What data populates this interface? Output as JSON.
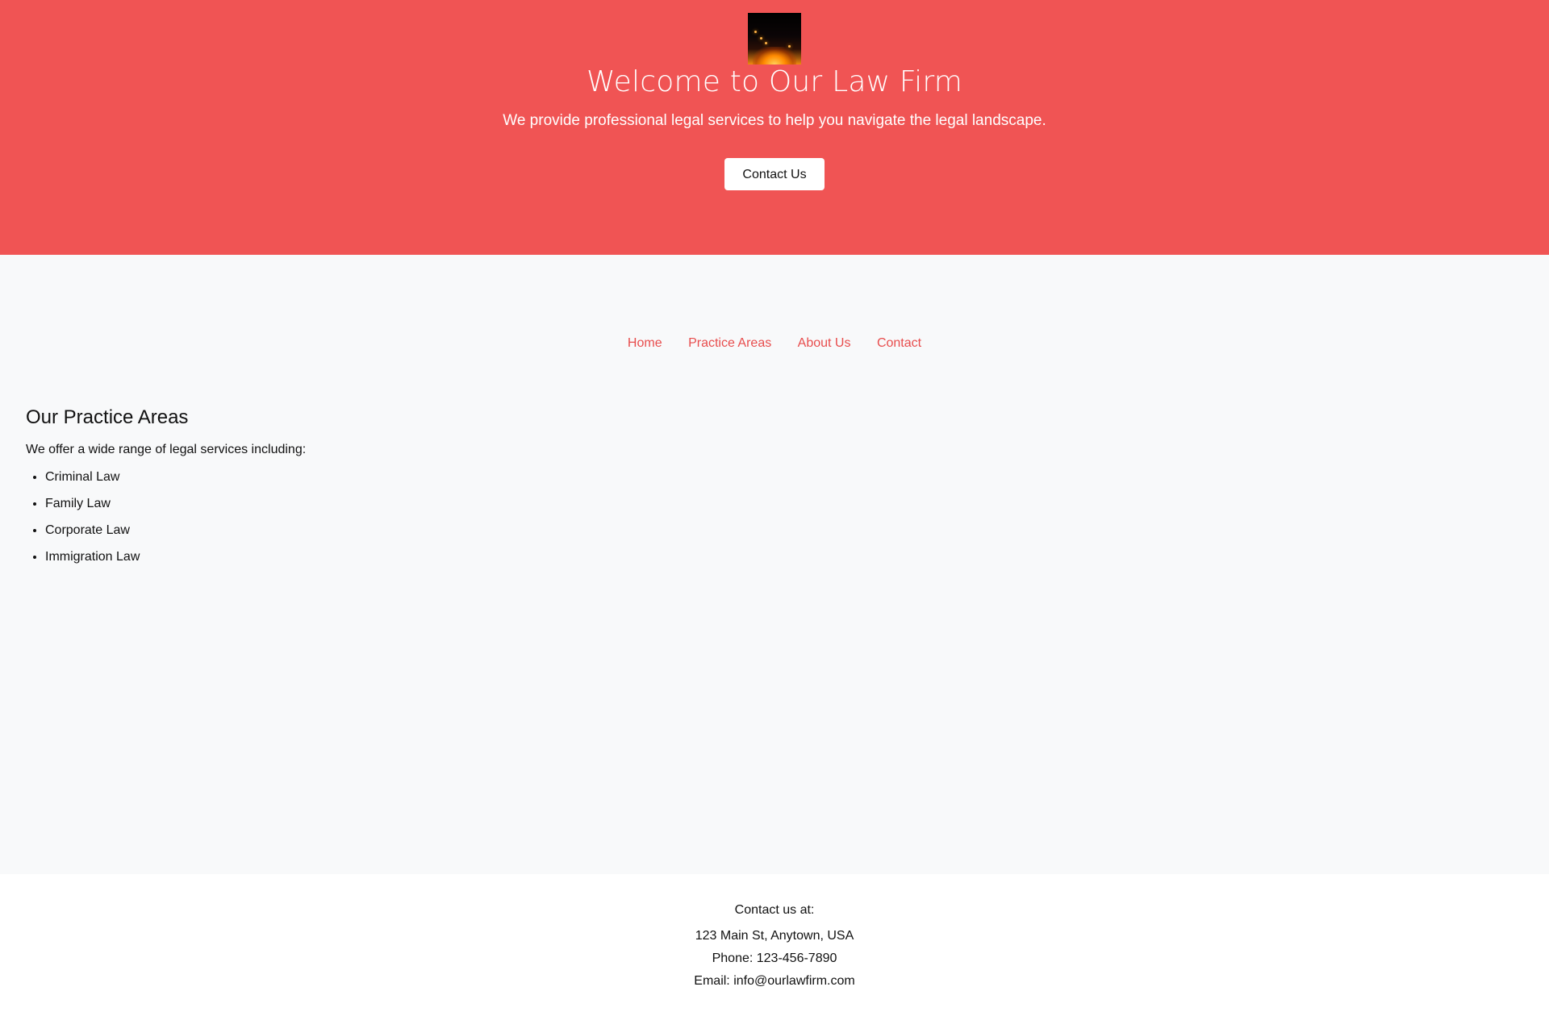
{
  "hero": {
    "title": "Welcome to Our Law Firm",
    "subtitle": "We provide professional legal services to help you navigate the legal landscape.",
    "button_label": "Contact Us",
    "background_color": "#f05454"
  },
  "nav": {
    "items": [
      {
        "label": "Home"
      },
      {
        "label": "Practice Areas"
      },
      {
        "label": "About Us"
      },
      {
        "label": "Contact"
      }
    ],
    "link_color": "#e84d4d"
  },
  "practice": {
    "heading": "Our Practice Areas",
    "intro": "We offer a wide range of legal services including:",
    "areas": [
      "Criminal Law",
      "Family Law",
      "Corporate Law",
      "Immigration Law"
    ]
  },
  "footer": {
    "heading": "Contact us at:",
    "address": "123 Main St, Anytown, USA",
    "phone": "Phone: 123-456-7890",
    "email": "Email: info@ourlawfirm.com"
  }
}
